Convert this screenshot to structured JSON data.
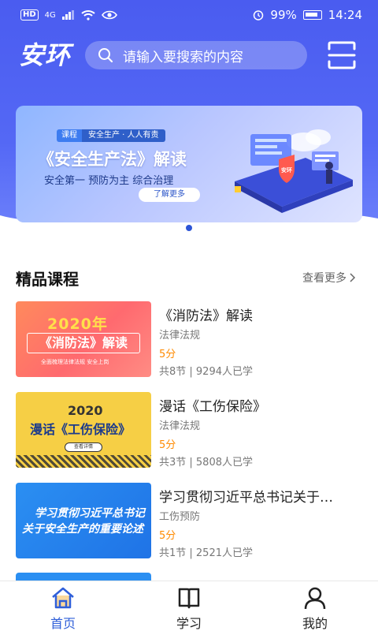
{
  "status_bar": {
    "hd": "HD",
    "signal": "4G",
    "battery_pct": "99%",
    "time": "14:24"
  },
  "header": {
    "logo": "安环",
    "search_placeholder": "请输入要搜索的内容"
  },
  "banner": {
    "tag": "课程",
    "tagline": "安全生产 · 人人有责",
    "title": "《安全生产法》解读",
    "subtitle": "安全第一   预防为主   综合治理",
    "button": "了解更多",
    "shield_text": "安环"
  },
  "section": {
    "title": "精品课程",
    "more": "查看更多"
  },
  "courses": [
    {
      "title": "《消防法》解读",
      "category": "法律法规",
      "score": "5分",
      "meta": "共8节 | 9294人已学",
      "thumb_year": "2020年",
      "thumb_title": "《消防法》解读",
      "thumb_sub": "全面梳理法律法规 安全上岗"
    },
    {
      "title": "漫话《工伤保险》",
      "category": "法律法规",
      "score": "5分",
      "meta": "共3节 | 5808人已学",
      "thumb_year": "2020",
      "thumb_title": "漫话《工伤保险》",
      "thumb_btn": "查看详情"
    },
    {
      "title": "学习贯彻习近平总书记关于…",
      "category": "工伤预防",
      "score": "5分",
      "meta": "共1节 | 2521人已学",
      "thumb_line1": "学习贯彻习近平总书记",
      "thumb_line2": "关于安全生产的重要论述"
    }
  ],
  "bottom_nav": {
    "home": "首页",
    "study": "学习",
    "me": "我的"
  },
  "colors": {
    "primary": "#4a5cf0",
    "active_tab": "#2f5fd9",
    "score": "#ff8a00"
  }
}
